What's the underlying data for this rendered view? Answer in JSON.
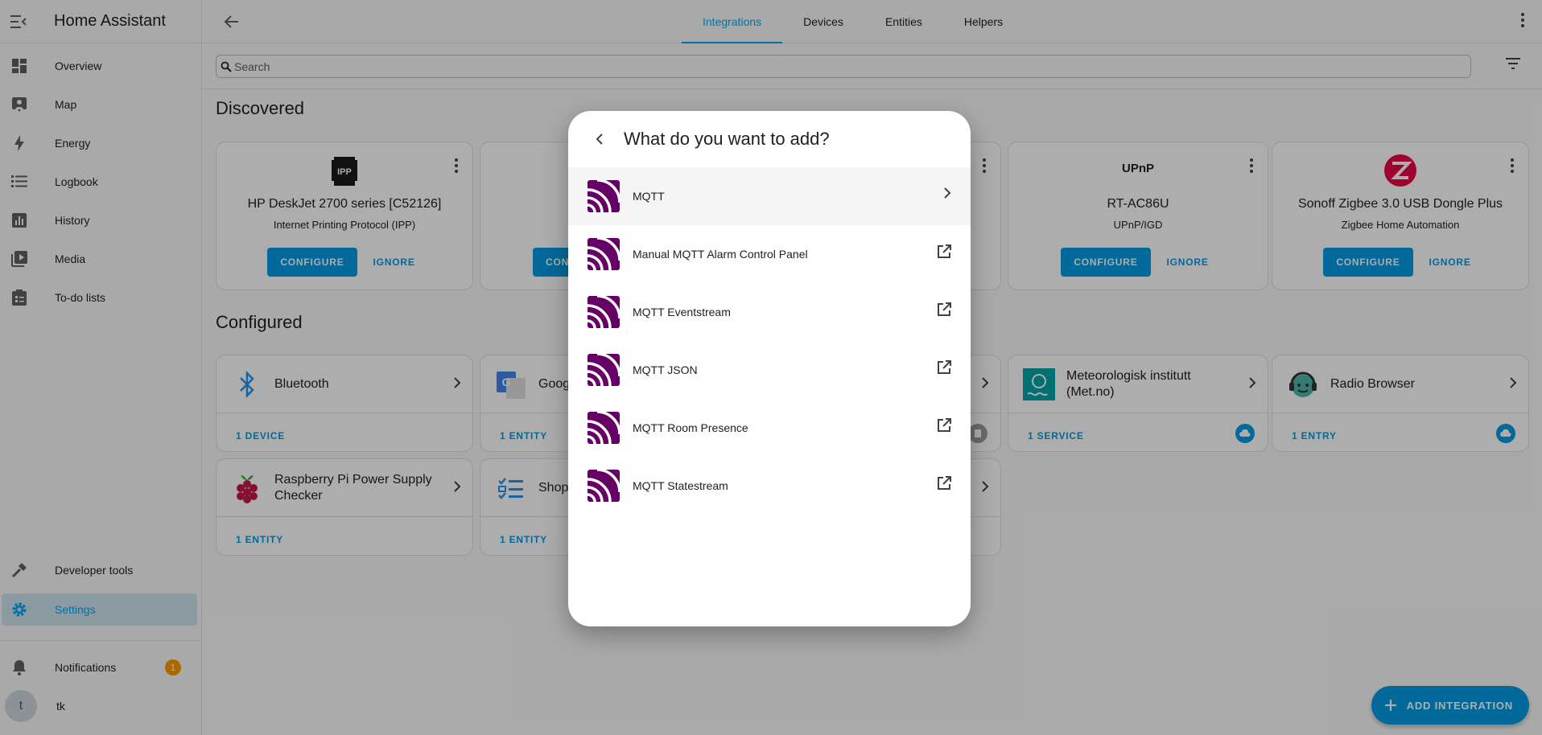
{
  "app": {
    "title": "Home Assistant"
  },
  "sidebar": {
    "items": [
      {
        "label": "Overview",
        "icon": "dashboard-icon"
      },
      {
        "label": "Map",
        "icon": "map-icon"
      },
      {
        "label": "Energy",
        "icon": "lightning-icon"
      },
      {
        "label": "Logbook",
        "icon": "list-icon"
      },
      {
        "label": "History",
        "icon": "chart-icon"
      },
      {
        "label": "Media",
        "icon": "media-icon"
      },
      {
        "label": "To-do lists",
        "icon": "clipboard-icon"
      }
    ],
    "developer_tools": "Developer tools",
    "settings": "Settings",
    "notifications": "Notifications",
    "notifications_count": "1",
    "user_initial": "t",
    "user_name": "tk"
  },
  "tabs": [
    {
      "label": "Integrations",
      "active": true
    },
    {
      "label": "Devices"
    },
    {
      "label": "Entities"
    },
    {
      "label": "Helpers"
    }
  ],
  "search": {
    "placeholder": "Search"
  },
  "discovered": {
    "title": "Discovered",
    "cards": [
      {
        "name": "HP DeskJet 2700 series [C52126]",
        "sub": "Internet Printing Protocol (IPP)",
        "configure": "CONFIGURE",
        "ignore": "IGNORE"
      },
      {
        "name": "RT-AC86U",
        "sub": "UPnP/IGD",
        "configure": "CONFIGURE",
        "ignore": "IGNORE"
      },
      {
        "name": "Sonoff Zigbee 3.0 USB Dongle Plus",
        "sub": "Zigbee Home Automation",
        "configure": "CONFIGURE",
        "ignore": "IGNORE"
      }
    ],
    "partial_configure": "CON",
    "ipp_logo_text": "IPP",
    "upnp_logo_text": "UPnP"
  },
  "configured": {
    "title": "Configured",
    "cards": [
      {
        "name": "Bluetooth",
        "footer": "1 DEVICE"
      },
      {
        "name": "Goog speec",
        "footer": "1 ENTITY"
      },
      {
        "name": "Meteorologisk institutt (Met.no)",
        "footer": "1 SERVICE"
      },
      {
        "name": "Radio Browser",
        "footer": "1 ENTRY"
      },
      {
        "name": "Raspberry Pi Power Supply Checker",
        "footer": "1 ENTITY"
      },
      {
        "name": "Shop",
        "footer": "1 ENTITY"
      }
    ]
  },
  "fab": {
    "label": "ADD INTEGRATION"
  },
  "dialog": {
    "title": "What do you want to add?",
    "items": [
      {
        "label": "MQTT",
        "trail": "chevron"
      },
      {
        "label": "Manual MQTT Alarm Control Panel",
        "trail": "open-in-new"
      },
      {
        "label": "MQTT Eventstream",
        "trail": "open-in-new"
      },
      {
        "label": "MQTT JSON",
        "trail": "open-in-new"
      },
      {
        "label": "MQTT Room Presence",
        "trail": "open-in-new"
      },
      {
        "label": "MQTT Statestream",
        "trail": "open-in-new"
      }
    ]
  },
  "colors": {
    "accent": "#03a9f4",
    "primary_button": "#039be5",
    "mqtt_purple": "#660066",
    "badge": "#ff9800"
  }
}
